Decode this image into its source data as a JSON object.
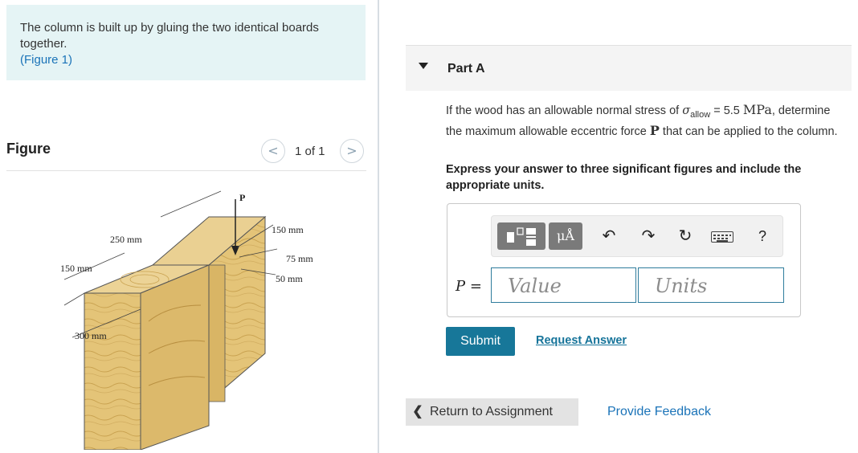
{
  "intro": {
    "text": "The column is built up by gluing the two identical boards together.",
    "figure_link": "(Figure 1)"
  },
  "figure_panel": {
    "title": "Figure",
    "counter": "1 of 1",
    "prev_icon": "chevron-left-icon",
    "next_icon": "chevron-right-icon",
    "labels": {
      "p": "P",
      "dim_250": "250 mm",
      "dim_150_left": "150 mm",
      "dim_300": "300 mm",
      "dim_150_top": "150 mm",
      "dim_75": "75 mm",
      "dim_50": "50 mm"
    }
  },
  "part": {
    "title": "Part A",
    "question_pre": "If the wood has an allowable normal stress of",
    "sigma": "σ",
    "sigma_sub": "allow",
    "stress_value": "= 5.5",
    "stress_unit": "MPa",
    "question_mid": ", determine the maximum allowable eccentric force",
    "force_symbol": "P",
    "question_post": "that can be applied to the column.",
    "instruction": "Express your answer to three significant figures and include the appropriate units."
  },
  "answer": {
    "variable": "P =",
    "value_placeholder": "Value",
    "units_placeholder": "Units",
    "toolbar": {
      "units_symbol": "μÅ",
      "help": "?",
      "icons": [
        "templates-icon",
        "units-icon",
        "undo-icon",
        "redo-icon",
        "reset-icon",
        "keyboard-icon",
        "help-icon"
      ]
    }
  },
  "actions": {
    "submit": "Submit",
    "request_answer": "Request Answer",
    "return": "Return to Assignment",
    "feedback": "Provide Feedback"
  },
  "colors": {
    "intro_bg": "#e5f4f5",
    "link": "#1a73b8",
    "submit_bg": "#177799",
    "field_border": "#2e7c9c"
  }
}
